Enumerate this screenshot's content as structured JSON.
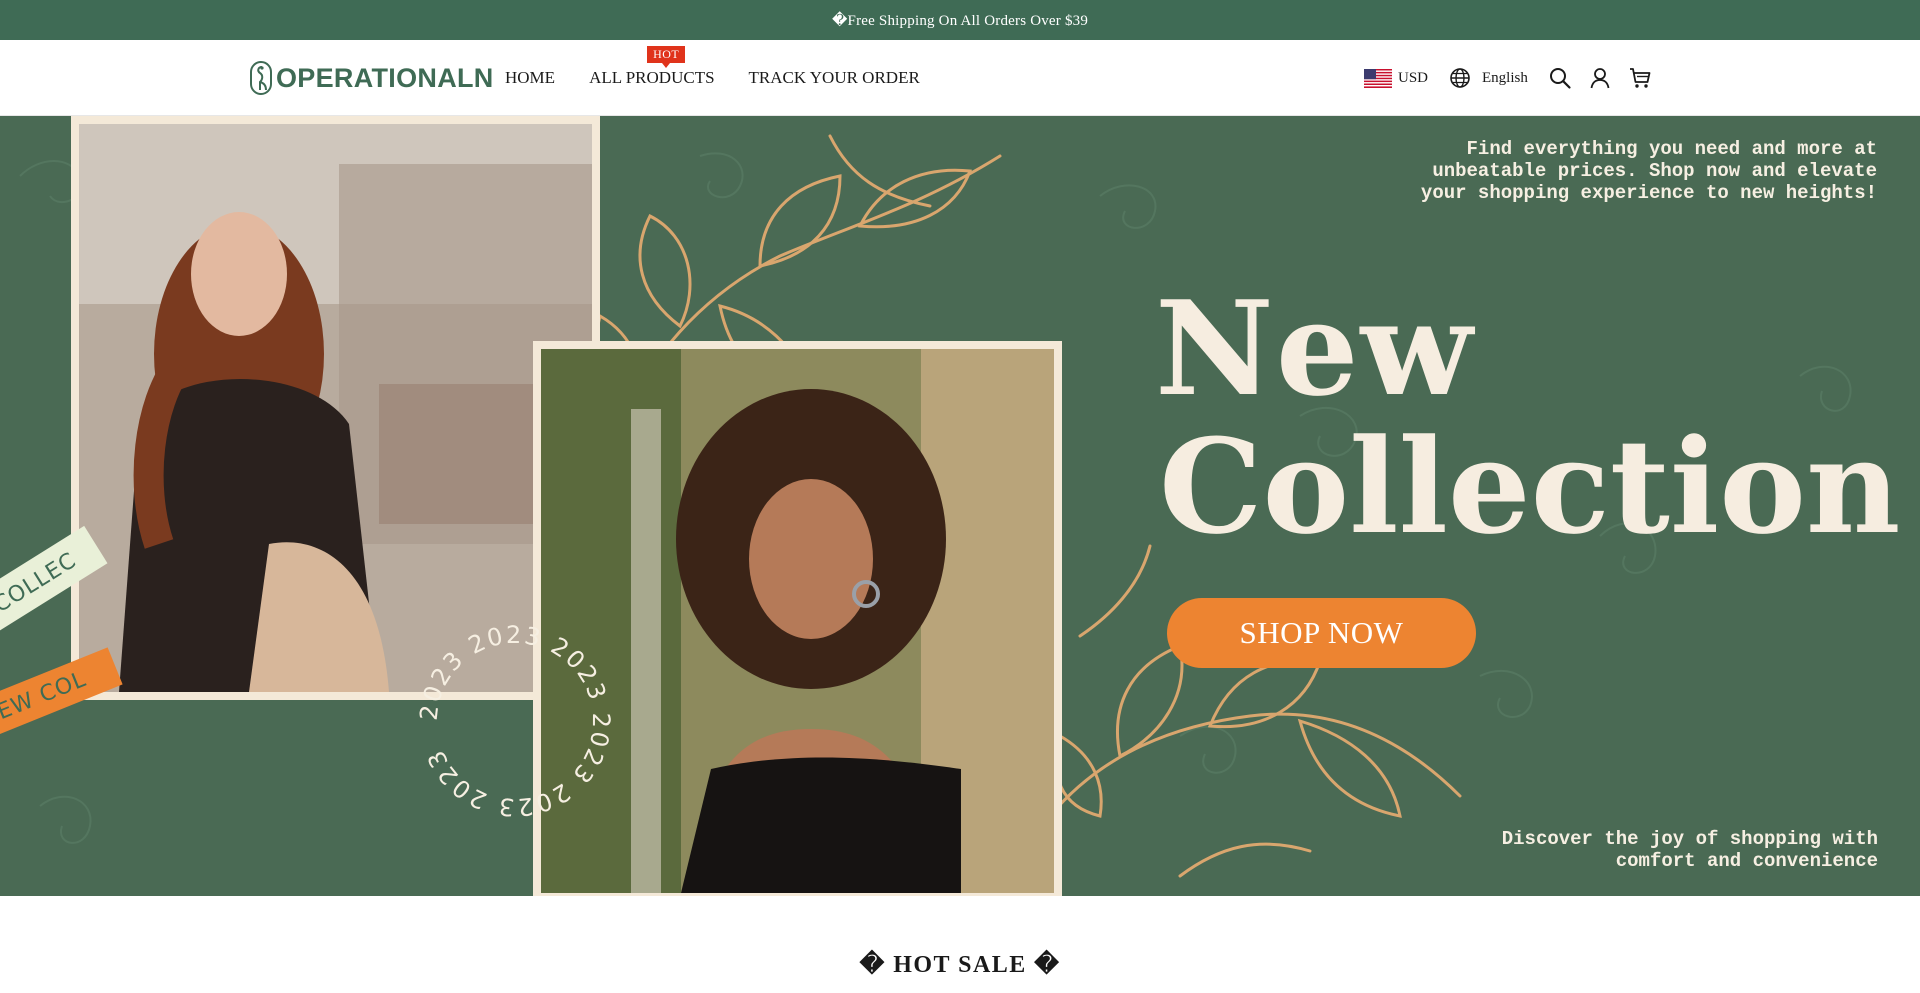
{
  "announcement": {
    "text": "�Free Shipping On All Orders Over $39"
  },
  "brand": {
    "name": "OPERATIONALN",
    "color": "#3f6b55",
    "logo_icon": "heron-icon"
  },
  "nav": {
    "items": [
      {
        "label": "HOME"
      },
      {
        "label": "ALL PRODUCTS",
        "badge": "HOT"
      },
      {
        "label": "TRACK YOUR ORDER"
      }
    ]
  },
  "utilities": {
    "currency": "USD",
    "currency_icon": "us-flag-icon",
    "language": "English",
    "language_icon": "globe-icon",
    "icons": [
      "search-icon",
      "account-icon",
      "cart-icon"
    ]
  },
  "hero": {
    "tagline_top": "Find everything you need and more at unbeatable prices. Shop now and elevate your shopping experience to new heights!",
    "headline_line1": "New",
    "headline_line2": "Collection",
    "cta": "SHOP NOW",
    "tagline_bottom": "Discover the joy of shopping with comfort and convenience",
    "ribbon_green": "COLLEC",
    "ribbon_orange": "EW COL",
    "circle_text": "2023 2023 2023 2023 2023 2023",
    "colors": {
      "background": "#4a6a54",
      "accent": "#ed8431",
      "leaf": "#d9a66e",
      "cream": "#f6ede0"
    }
  },
  "section": {
    "title": "� HOT SALE �"
  }
}
